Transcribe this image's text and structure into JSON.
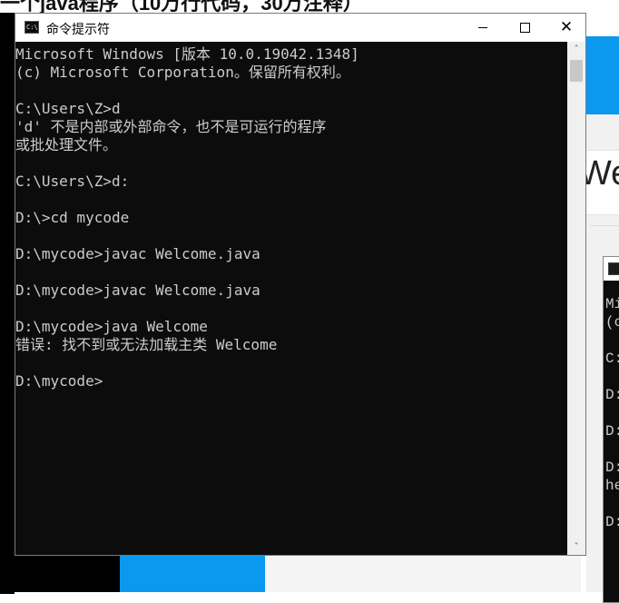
{
  "background": {
    "heading_fragment": "一个java程序（10万行代码，30万注释）",
    "welcome_fragment": "Wel"
  },
  "window": {
    "title": "命令提示符",
    "icon": "cmd-icon",
    "controls": {
      "minimize": "minimize-icon",
      "maximize": "maximize-icon",
      "close": "close-icon",
      "close_glyph": "✕"
    }
  },
  "console": {
    "lines": [
      "Microsoft Windows [版本 10.0.19042.1348]",
      "(c) Microsoft Corporation。保留所有权利。",
      "",
      "C:\\Users\\Z>d",
      "'d' 不是内部或外部命令，也不是可运行的程序",
      "或批处理文件。",
      "",
      "C:\\Users\\Z>d:",
      "",
      "D:\\>cd mycode",
      "",
      "D:\\mycode>javac Welcome.java",
      "",
      "D:\\mycode>javac Welcome.java",
      "",
      "D:\\mycode>java Welcome",
      "错误: 找不到或无法加载主类 Welcome",
      "",
      "D:\\mycode>"
    ]
  },
  "second_console": {
    "lines": [
      "Mi",
      "(c",
      "",
      "C:",
      "",
      "D:",
      "",
      "D:",
      "",
      "D:",
      "he",
      "",
      "D:"
    ]
  },
  "colors": {
    "console_bg": "#0c0c0c",
    "console_text": "#cccccc",
    "accent_blue": "#0b98ef"
  }
}
